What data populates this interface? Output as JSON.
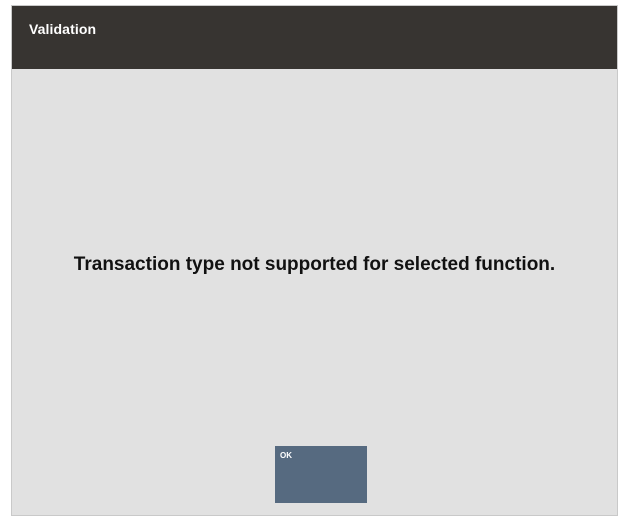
{
  "dialog": {
    "title": "Validation",
    "message": "Transaction type not supported for selected function.",
    "ok_label": "OK"
  },
  "colors": {
    "titlebar": "#373431",
    "background": "#e1e1e1",
    "button": "#566a80"
  }
}
